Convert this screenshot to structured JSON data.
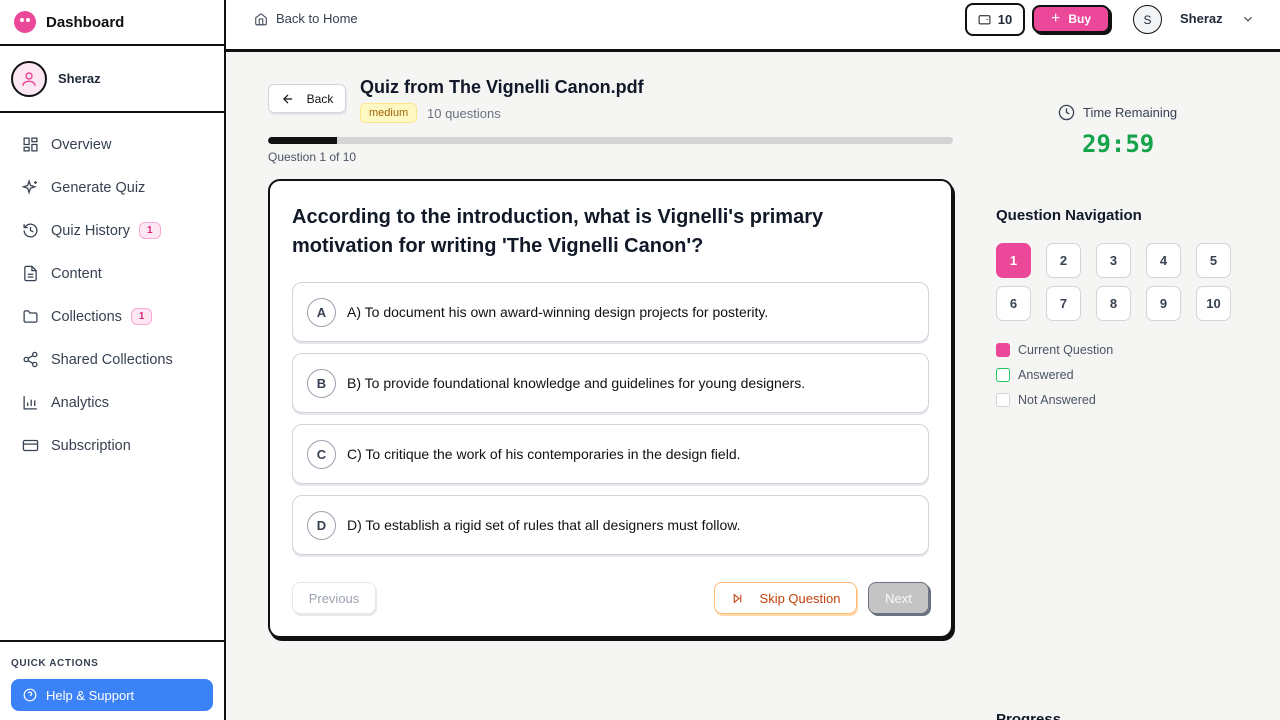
{
  "sidebar": {
    "brand": "Dashboard",
    "user": "Sheraz",
    "items": [
      {
        "label": "Overview",
        "icon": "grid-icon"
      },
      {
        "label": "Generate Quiz",
        "icon": "sparkles-icon"
      },
      {
        "label": "Quiz History",
        "icon": "history-icon",
        "badge": "1"
      },
      {
        "label": "Content",
        "icon": "document-icon"
      },
      {
        "label": "Collections",
        "icon": "folder-icon",
        "badge": "1"
      },
      {
        "label": "Shared Collections",
        "icon": "share-icon"
      },
      {
        "label": "Analytics",
        "icon": "bar-chart-icon"
      },
      {
        "label": "Subscription",
        "icon": "credit-card-icon"
      }
    ],
    "quick_actions_label": "QUICK ACTIONS",
    "help_label": "Help & Support"
  },
  "topbar": {
    "back_home": "Back to Home",
    "credits": "10",
    "buy_label": "Buy",
    "avatar_initial": "S",
    "user": "Sheraz"
  },
  "quiz": {
    "back_label": "Back",
    "title": "Quiz from The Vignelli Canon.pdf",
    "difficulty": "medium",
    "question_count": "10 questions",
    "progress_label": "Question 1 of 10",
    "progress_fraction": 0.1,
    "question": "According to the introduction, what is Vignelli's primary motivation for writing 'The Vignelli Canon'?",
    "options": [
      {
        "letter": "A",
        "text": "A) To document his own award-winning design projects for posterity."
      },
      {
        "letter": "B",
        "text": "B) To provide foundational knowledge and guidelines for young designers."
      },
      {
        "letter": "C",
        "text": "C) To critique the work of his contemporaries in the design field."
      },
      {
        "letter": "D",
        "text": "D) To establish a rigid set of rules that all designers must follow."
      }
    ],
    "previous_label": "Previous",
    "skip_label": "Skip Question",
    "next_label": "Next"
  },
  "panel": {
    "timer_label": "Time Remaining",
    "timer": "29:59",
    "nav_title": "Question Navigation",
    "numbers": [
      "1",
      "2",
      "3",
      "4",
      "5",
      "6",
      "7",
      "8",
      "9",
      "10"
    ],
    "current": "1",
    "legend": {
      "current": "Current Question",
      "answered": "Answered",
      "not_answered": "Not Answered"
    },
    "progress_heading": "Progress"
  },
  "colors": {
    "accent": "#ec4899",
    "timer": "#16a34a",
    "help": "#3b82f6",
    "skip": "#c2410c"
  }
}
